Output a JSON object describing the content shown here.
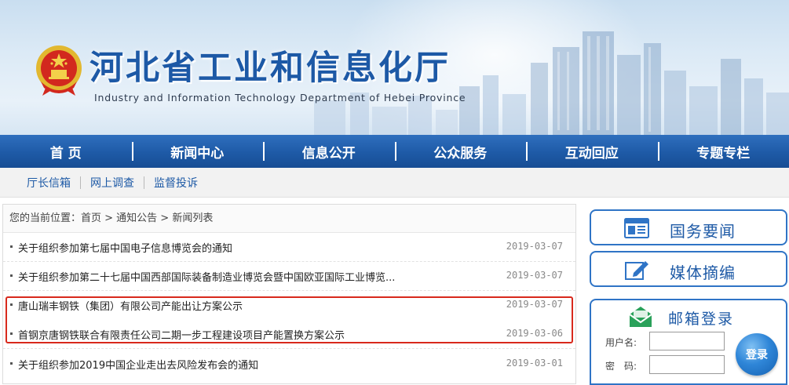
{
  "banner": {
    "title": "河北省工业和信息化厅",
    "subtitle": "Industry and Information Technology Department of Hebei Province"
  },
  "main_nav": [
    {
      "label": "首 页"
    },
    {
      "label": "新闻中心"
    },
    {
      "label": "信息公开"
    },
    {
      "label": "公众服务"
    },
    {
      "label": "互动回应"
    },
    {
      "label": "专题专栏"
    }
  ],
  "sub_nav": [
    {
      "label": "厅长信箱"
    },
    {
      "label": "网上调查"
    },
    {
      "label": "监督投诉"
    }
  ],
  "breadcrumb": "您的当前位置：首页 > 通知公告 > 新闻列表",
  "news": [
    {
      "title": "关于组织参加第七届中国电子信息博览会的通知",
      "date": "2019-03-07"
    },
    {
      "title": "关于组织参加第二十七届中国西部国际装备制造业博览会暨中国欧亚国际工业博览...",
      "date": "2019-03-07"
    },
    {
      "title": "唐山瑞丰钢铁（集团）有限公司产能出让方案公示",
      "date": "2019-03-07"
    },
    {
      "title": "首钢京唐钢铁联合有限责任公司二期一步工程建设项目产能置换方案公示",
      "date": "2019-03-06"
    },
    {
      "title": "关于组织参加2019中国企业走出去风险发布会的通知",
      "date": "2019-03-01"
    }
  ],
  "side": {
    "state_news_label": "国务要闻",
    "media_digest_label": "媒体摘编",
    "mail_title": "邮箱登录",
    "username_label": "用户名:",
    "password_label": "密　码:",
    "username_value": "",
    "password_value": "",
    "login_label": "登录"
  },
  "colors": {
    "brand_blue": "#1e5aa6",
    "highlight_red": "#d8291c",
    "envelope_green": "#2aa15a"
  }
}
